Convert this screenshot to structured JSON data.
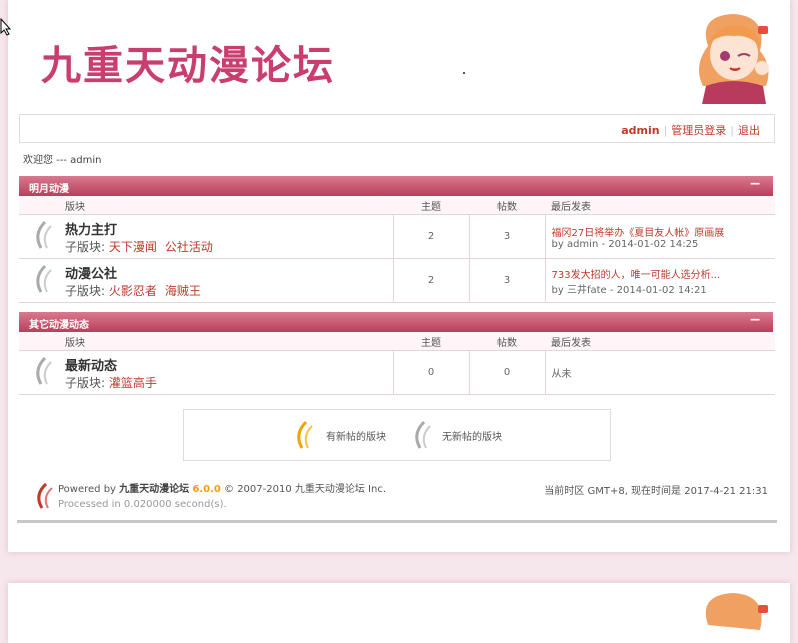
{
  "header": {
    "logo_text": "九重天动漫论坛"
  },
  "userbar": {
    "username": "admin",
    "admin_login": "管理员登录",
    "logout": "退出"
  },
  "welcome": "欢迎您 --- admin",
  "sections": [
    {
      "title": "明月动漫",
      "collapse": "−",
      "headers": {
        "forum": "版块",
        "topics": "主题",
        "posts": "帖数",
        "last": "最后发表"
      },
      "forums": [
        {
          "name": "热力主打",
          "sub_label": "子版块:",
          "subforums": [
            "天下漫闻",
            "公社活动"
          ],
          "topics": "2",
          "posts": "3",
          "last_title": "福冈27日将举办《夏目友人帐》原画展",
          "last_by": "by admin - 2014-01-02 14:25"
        },
        {
          "name": "动漫公社",
          "sub_label": "子版块:",
          "subforums": [
            "火影忍者",
            "海贼王"
          ],
          "topics": "2",
          "posts": "3",
          "last_title": "733发大招的人，唯一可能人选分析...",
          "last_by": "by 三井fate - 2014-01-02 14:21"
        }
      ]
    },
    {
      "title": "其它动漫动态",
      "collapse": "−",
      "headers": {
        "forum": "版块",
        "topics": "主题",
        "posts": "帖数",
        "last": "最后发表"
      },
      "forums": [
        {
          "name": "最新动态",
          "sub_label": "子版块:",
          "subforums": [
            "灌篮高手"
          ],
          "topics": "0",
          "posts": "0",
          "last_title": "",
          "last_by": "从未"
        }
      ]
    }
  ],
  "legend": {
    "new": "有新帖的版块",
    "none": "无新帖的版块"
  },
  "footer": {
    "powered": "Powered by",
    "product": "九重天动漫论坛",
    "version": "6.0.0",
    "copyright": "© 2007-2010 九重天动漫论坛 Inc.",
    "processed": "Processed in 0.020000 second(s).",
    "timezone": "当前时区 GMT+8, 现在时间是 2017-4-21 21:31"
  },
  "colors": {
    "accent": "#c83e6e",
    "section_header": "#c24b66",
    "link": "#c0392b"
  }
}
